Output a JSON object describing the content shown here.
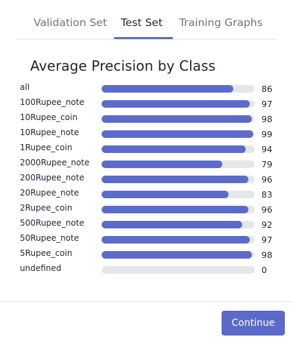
{
  "tabs": [
    {
      "label": "Validation Set",
      "active": false
    },
    {
      "label": "Test Set",
      "active": true
    },
    {
      "label": "Training Graphs",
      "active": false
    }
  ],
  "title": "Average Precision by Class",
  "rows": [
    {
      "label": "all",
      "value": 86
    },
    {
      "label": "100Rupee_note",
      "value": 97
    },
    {
      "label": "10Rupee_coin",
      "value": 98
    },
    {
      "label": "10Rupee_note",
      "value": 99
    },
    {
      "label": "1Rupee_coin",
      "value": 94
    },
    {
      "label": "2000Rupee_note",
      "value": 79
    },
    {
      "label": "200Rupee_note",
      "value": 96
    },
    {
      "label": "20Rupee_note",
      "value": 83
    },
    {
      "label": "2Rupee_coin",
      "value": 96
    },
    {
      "label": "500Rupee_note",
      "value": 92
    },
    {
      "label": "50Rupee_note",
      "value": 97
    },
    {
      "label": "5Rupee_coin",
      "value": 98
    },
    {
      "label": "undefined",
      "value": 0
    }
  ],
  "bar_max": 100,
  "footer": {
    "continue_label": "Continue"
  },
  "colors": {
    "accent": "#5c6bc9",
    "track": "#e5e6e8",
    "inactive_tab": "#6b7380",
    "text": "#1f2430"
  }
}
